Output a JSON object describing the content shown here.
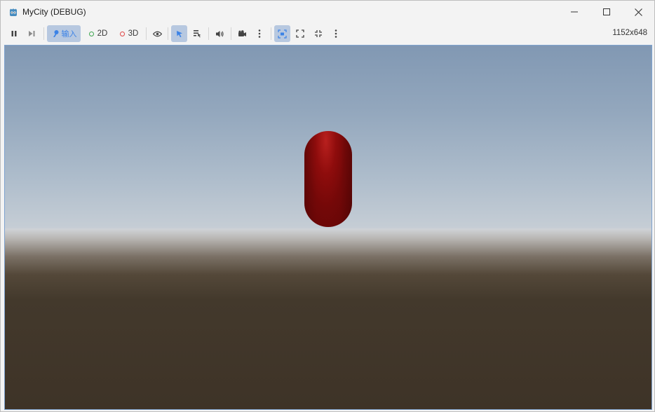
{
  "window": {
    "title": "MyCity (DEBUG)",
    "app_icon": "godot-icon",
    "controls": {
      "minimize_icon": "minimize-icon",
      "maximize_icon": "maximize-icon",
      "close_icon": "close-icon"
    }
  },
  "toolbar": {
    "pause_icon": "pause-icon",
    "step_icon": "next-frame-icon",
    "input_label": "输入",
    "input_icon": "joypad-icon",
    "mode_2d_label": "2D",
    "mode_3d_label": "3D",
    "visibility_icon": "eye-icon",
    "select_icon": "cursor-select-icon",
    "list_icon": "list-select-icon",
    "audio_icon": "speaker-icon",
    "camera_icon": "camera-icon",
    "more_icon": "kebab-menu-icon",
    "fit_icon": "fit-view-icon",
    "expand_icon": "expand-icon",
    "shrink_icon": "shrink-icon",
    "more2_icon": "kebab-menu-icon",
    "resolution": "1152x648",
    "colors": {
      "active_bg": "#b7c8e0",
      "input_accent": "#3b82e6",
      "ring_2d": "#3fa54f",
      "ring_3d": "#e04646"
    }
  },
  "viewport": {
    "object": "red-capsule",
    "colors": {
      "sky_top": "#8198b3",
      "horizon": "#cfd2d6",
      "ground": "#3e3327",
      "capsule": "#7a0808"
    }
  }
}
